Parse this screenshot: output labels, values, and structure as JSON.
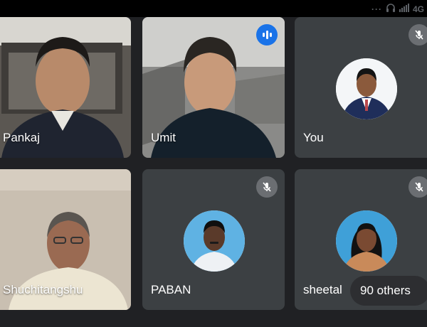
{
  "status_bar": {
    "network": "4G"
  },
  "participants": [
    {
      "name": "Pankaj",
      "mic": "on",
      "kind": "video"
    },
    {
      "name": "Umit",
      "mic": "speaking",
      "kind": "video"
    },
    {
      "name": "You",
      "mic": "muted",
      "kind": "avatar"
    },
    {
      "name": "Shuchitangshu",
      "mic": "on",
      "kind": "video"
    },
    {
      "name": "PABAN",
      "mic": "muted",
      "kind": "avatar"
    },
    {
      "name": "sheetal",
      "mic": "muted",
      "kind": "avatar"
    }
  ],
  "others_label": "90 others",
  "colors": {
    "background": "#202124",
    "tile": "#3c4043",
    "speaking": "#1a73e8",
    "muted_badge": "#6b6e72"
  },
  "icons": [
    "signal-icon",
    "headset-icon",
    "mic-off-icon",
    "speaking-indicator-icon"
  ]
}
